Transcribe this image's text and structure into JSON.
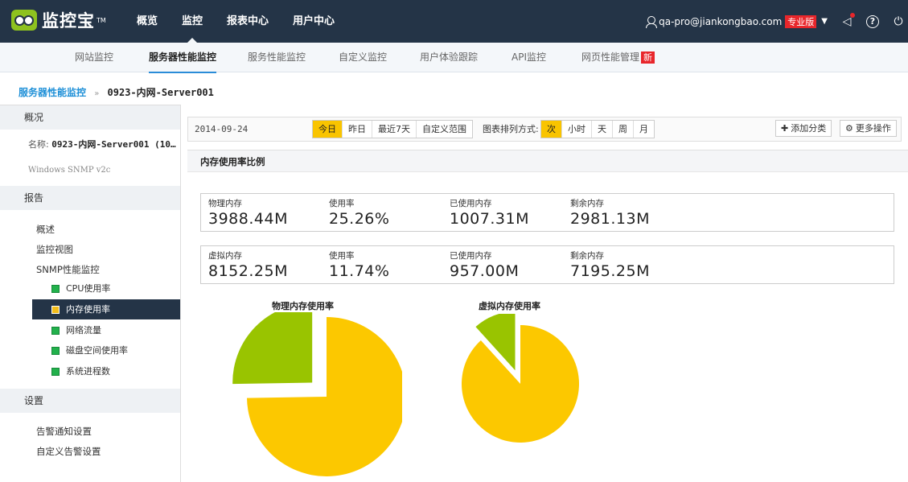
{
  "topbar": {
    "logo_text": "监控宝",
    "logo_tm": "TM",
    "nav": [
      {
        "label": "概览"
      },
      {
        "label": "监控"
      },
      {
        "label": "报表中心"
      },
      {
        "label": "用户中心"
      }
    ],
    "user_email": "qa-pro@jiankongbao.com",
    "plan_badge": "专业版",
    "badge_color": "#e8262b",
    "brand_bg": "#243447"
  },
  "subnav": [
    {
      "label": "网站监控"
    },
    {
      "label": "服务器性能监控"
    },
    {
      "label": "服务性能监控"
    },
    {
      "label": "自定义监控"
    },
    {
      "label": "用户体验跟踪"
    },
    {
      "label": "API监控"
    },
    {
      "label": "网页性能管理",
      "badge": "新"
    }
  ],
  "breadcrumb": {
    "parent": "服务器性能监控",
    "separator": "»",
    "current": "0923-内网-Server001"
  },
  "sidebar": {
    "overview_head": "概况",
    "name_label": "名称:",
    "name_value": "0923-内网-Server001 (10…",
    "sub_info": "Windows SNMP v2c",
    "report_head": "报告",
    "report_links": [
      "概述",
      "监控视图",
      "SNMP性能监控"
    ],
    "snmp_items": [
      {
        "label": "CPU使用率",
        "active": false
      },
      {
        "label": "内存使用率",
        "active": true
      },
      {
        "label": "网络流量",
        "active": false
      },
      {
        "label": "磁盘空间使用率",
        "active": false
      },
      {
        "label": "系统进程数",
        "active": false
      }
    ],
    "settings_head": "设置",
    "settings_links": [
      "告警通知设置",
      "自定义告警设置"
    ]
  },
  "toolbar": {
    "date": "2014-09-24",
    "range_buttons": [
      "今日",
      "昨日",
      "最近7天",
      "自定义范围"
    ],
    "range_active": "今日",
    "sort_label": "图表排列方式:",
    "granularity_buttons": [
      "次",
      "小时",
      "天",
      "周",
      "月"
    ],
    "granularity_active": "次",
    "add_category": "添加分类",
    "more_actions": "更多操作",
    "accent_color": "#f9c400"
  },
  "panel": {
    "title": "内存使用率比例",
    "physical": {
      "labels": [
        "物理内存",
        "使用率",
        "已使用内存",
        "剩余内存"
      ],
      "values": [
        "3988.44M",
        "25.26%",
        "1007.31M",
        "2981.13M"
      ]
    },
    "virtual": {
      "labels": [
        "虚拟内存",
        "使用率",
        "已使用内存",
        "剩余内存"
      ],
      "values": [
        "8152.25M",
        "11.74%",
        "957.00M",
        "7195.25M"
      ]
    }
  },
  "chart_data": [
    {
      "type": "pie",
      "title": "物理内存使用率",
      "slices": [
        {
          "value": 25.26,
          "color": "#99c400",
          "exploded": true
        },
        {
          "value": 74.74,
          "color": "#fcc800",
          "exploded": false
        }
      ]
    },
    {
      "type": "pie",
      "title": "虚拟内存使用率",
      "slices": [
        {
          "value": 11.74,
          "color": "#99c400",
          "exploded": true
        },
        {
          "value": 88.26,
          "color": "#fcc800",
          "exploded": false
        }
      ]
    }
  ]
}
